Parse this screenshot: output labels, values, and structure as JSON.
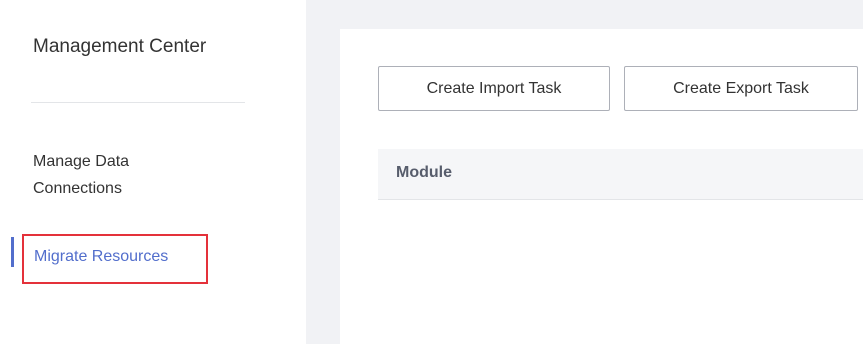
{
  "sidebar": {
    "title": "Management Center",
    "items": [
      {
        "label": "Manage Data Connections",
        "line1": "Manage Data",
        "line2": "Connections",
        "active": false
      },
      {
        "label": "Migrate Resources",
        "active": true
      }
    ]
  },
  "toolbar": {
    "import_label": "Create Import Task",
    "export_label": "Create Export Task"
  },
  "table": {
    "columns": [
      "Module"
    ]
  },
  "colors": {
    "accent": "#526ecc",
    "highlight_border": "#e4313a",
    "page_background": "#f1f2f5",
    "table_header_background": "#f5f6f8"
  }
}
